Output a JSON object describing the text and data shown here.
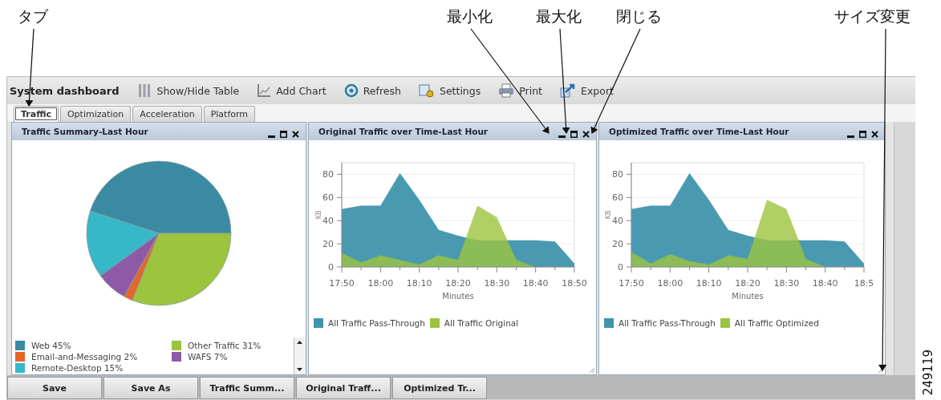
{
  "callouts": [
    {
      "label": "タブ",
      "kind": "tab"
    },
    {
      "label": "最小化",
      "kind": "minimize"
    },
    {
      "label": "最大化",
      "kind": "maximize"
    },
    {
      "label": "閉じる",
      "kind": "close"
    },
    {
      "label": "サイズ変更",
      "kind": "resize"
    }
  ],
  "figure_number": "249119",
  "toolbar": {
    "title": "System dashboard",
    "buttons": [
      {
        "label": "Show/Hide Table",
        "kind": "table"
      },
      {
        "label": "Add Chart",
        "kind": "chart"
      },
      {
        "label": "Refresh",
        "kind": "refresh"
      },
      {
        "label": "Settings",
        "kind": "settings"
      },
      {
        "label": "Print",
        "kind": "print"
      },
      {
        "label": "Export",
        "kind": "export"
      }
    ]
  },
  "tabs": [
    {
      "label": "Traffic",
      "selected": true
    },
    {
      "label": "Optimization",
      "selected": false
    },
    {
      "label": "Acceleration",
      "selected": false
    },
    {
      "label": "Platform",
      "selected": false
    }
  ],
  "panels": [
    {
      "title": "Traffic Summary-Last Hour",
      "chart_data": {
        "type": "pie",
        "categories": [
          "Web 45%",
          "Other Traffic 31%",
          "Email-and-Messaging 2%",
          "WAFS 7%",
          "Remote-Desktop 15%"
        ],
        "values": [
          45,
          31,
          2,
          7,
          15
        ]
      },
      "legend": [
        {
          "color": "#3a8aa3"
        },
        {
          "color": "#9cc43f"
        },
        {
          "color": "#e4662a"
        },
        {
          "color": "#8e5aa8"
        },
        {
          "color": "#36b8c8"
        }
      ]
    },
    {
      "title": "Original Traffic over Time-Last Hour",
      "chart_data": {
        "type": "area",
        "xlabel": "Minutes",
        "ylabel": "KB",
        "categories": [
          "17:50",
          null,
          "18:00",
          null,
          "18:10",
          null,
          "18:20",
          null,
          "18:30",
          null,
          "18:40",
          null,
          "18:50"
        ],
        "grid": true,
        "ylim": [
          0,
          90
        ],
        "yticks": [
          0,
          20,
          40,
          60,
          80
        ],
        "series": [
          {
            "name": "All Traffic Pass-Through",
            "color": "#3f95ad",
            "values": [
              50,
              53,
              53,
              81,
              58,
              32,
              27,
              23,
              23,
              23,
              23,
              22,
              3
            ]
          },
          {
            "name": "All Traffic Original",
            "color": "#9cc43f",
            "values": [
              12,
              4,
              10,
              6,
              2,
              10,
              6,
              53,
              43,
              6,
              0,
              null,
              null
            ]
          }
        ]
      }
    },
    {
      "title": "Optimized Traffic over Time-Last Hour",
      "chart_data": {
        "type": "area",
        "xlabel": "Minutes",
        "ylabel": "KB",
        "categories": [
          "17:50",
          null,
          "18:00",
          null,
          "18:10",
          null,
          "18:20",
          null,
          "18:30",
          null,
          "18:40",
          null,
          "18:5"
        ],
        "grid": true,
        "ylim": [
          0,
          90
        ],
        "yticks": [
          0,
          20,
          40,
          60,
          80
        ],
        "series": [
          {
            "name": "All Traffic Pass-Through",
            "color": "#3f95ad",
            "values": [
              50,
              53,
              53,
              81,
              58,
              32,
              27,
              23,
              23,
              23,
              23,
              22,
              3
            ]
          },
          {
            "name": "All Traffic Optimized",
            "color": "#9cc43f",
            "values": [
              13,
              3,
              11,
              5,
              2,
              10,
              7,
              58,
              50,
              7,
              0,
              null,
              null
            ]
          }
        ]
      }
    }
  ],
  "bottom_buttons": [
    {
      "label": "Save"
    },
    {
      "label": "Save As"
    },
    {
      "label": "Traffic Summ..."
    },
    {
      "label": "Original Traff..."
    },
    {
      "label": "Optimized Tr..."
    }
  ]
}
